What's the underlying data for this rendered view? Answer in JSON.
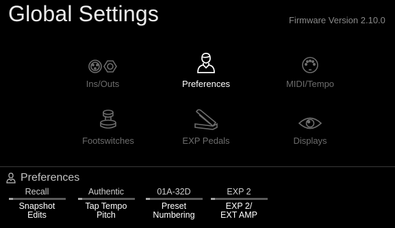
{
  "header": {
    "title": "Global Settings",
    "firmware": "Firmware Version 2.10.0"
  },
  "menu": {
    "items": [
      {
        "label": "Ins/Outs",
        "icon": "xlr-connector-icon",
        "selected": false
      },
      {
        "label": "Preferences",
        "icon": "person-icon",
        "selected": true
      },
      {
        "label": "MIDI/Tempo",
        "icon": "midi-port-icon",
        "selected": false
      },
      {
        "label": "Footswitches",
        "icon": "footswitch-icon",
        "selected": false
      },
      {
        "label": "EXP Pedals",
        "icon": "expression-pedal-icon",
        "selected": false
      },
      {
        "label": "Displays",
        "icon": "eye-icon",
        "selected": false
      }
    ]
  },
  "section": {
    "label": "Preferences",
    "icon": "person-icon"
  },
  "params": [
    {
      "value": "Recall",
      "name_line1": "Snapshot",
      "name_line2": "Edits"
    },
    {
      "value": "Authentic",
      "name_line1": "Tap Tempo",
      "name_line2": "Pitch"
    },
    {
      "value": "01A-32D",
      "name_line1": "Preset",
      "name_line2": "Numbering"
    },
    {
      "value": "EXP 2",
      "name_line1": "EXP 2/",
      "name_line2": "EXT AMP"
    }
  ],
  "colors": {
    "background": "#000000",
    "active_label": "#ffffff",
    "inactive_label": "#6d6d6d",
    "accent_bar": "#a6a6a6"
  }
}
